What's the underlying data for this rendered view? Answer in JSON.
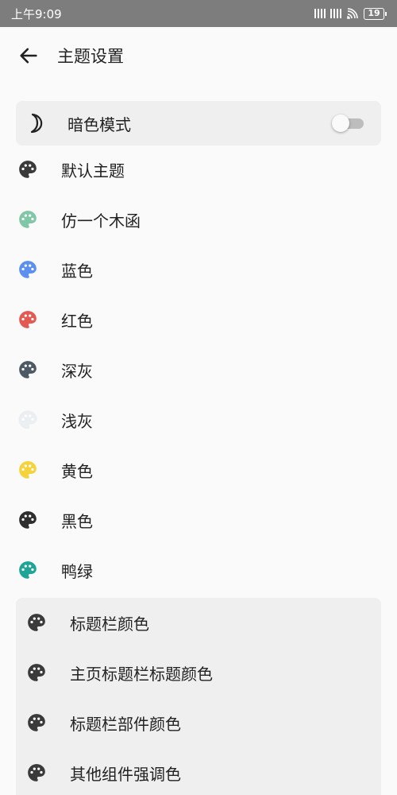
{
  "status_bar": {
    "time": "上午9:09",
    "battery": "19"
  },
  "header": {
    "title": "主题设置"
  },
  "dark_mode": {
    "label": "暗色模式",
    "enabled": false
  },
  "themes": [
    {
      "label": "默认主题",
      "color": "#3a3a3a"
    },
    {
      "label": "仿一个木函",
      "color": "#7fc7a6"
    },
    {
      "label": "蓝色",
      "color": "#5b8ff0"
    },
    {
      "label": "红色",
      "color": "#e35a52"
    },
    {
      "label": "深灰",
      "color": "#4d5a66"
    },
    {
      "label": "浅灰",
      "color": "#eceff1"
    },
    {
      "label": "黄色",
      "color": "#f4d33c"
    },
    {
      "label": "黑色",
      "color": "#2e2e2e"
    },
    {
      "label": "鸭绿",
      "color": "#1fa497"
    }
  ],
  "color_settings": [
    {
      "label": "标题栏颜色",
      "color": "#3a3a3a"
    },
    {
      "label": "主页标题栏标题颜色",
      "color": "#3a3a3a"
    },
    {
      "label": "标题栏部件颜色",
      "color": "#3a3a3a"
    },
    {
      "label": "其他组件强调色",
      "color": "#3a3a3a"
    }
  ],
  "icons": {
    "back": "back-arrow-icon",
    "dark_mode": "moon-icon",
    "theme": "palette-icon"
  }
}
